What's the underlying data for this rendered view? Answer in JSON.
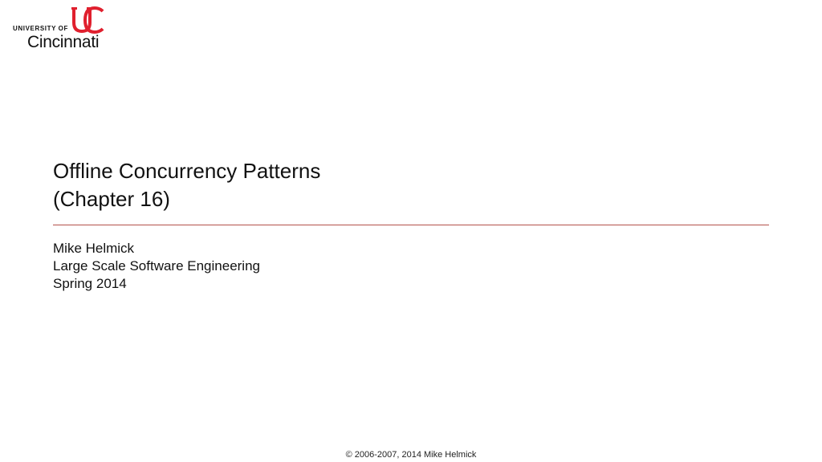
{
  "logo": {
    "university_text": "UNIVERSITY OF",
    "city_text": "Cincinnati",
    "mark_icon": "uc-logo-icon",
    "mark_color": "#e0202e"
  },
  "title": {
    "line1": "Offline Concurrency Patterns",
    "line2": "(Chapter 16)"
  },
  "rule_color": "#b3504a",
  "subtitle": {
    "author": "Mike Helmick",
    "course": "Large Scale Software Engineering",
    "term": "Spring 2014"
  },
  "footer": {
    "copyright": "© 2006-2007, 2014 Mike Helmick"
  }
}
